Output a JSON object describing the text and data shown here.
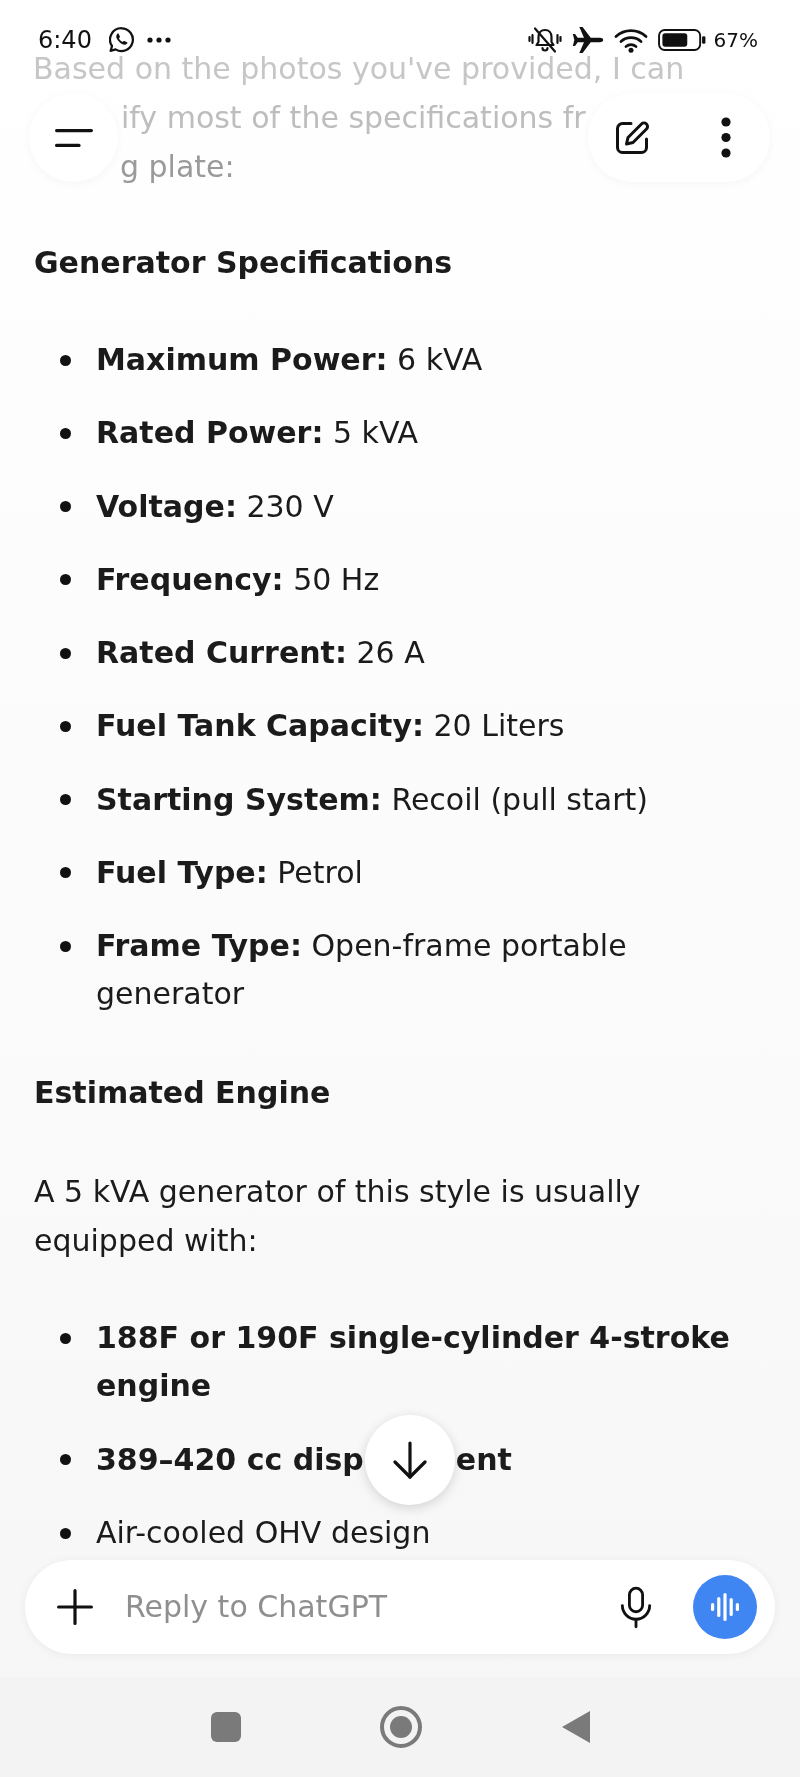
{
  "status_bar": {
    "time": "6:40",
    "battery": "67%"
  },
  "message": {
    "cut_lines": [
      "Based on the photos you've provided, I can",
      "ify most of the specifications fr",
      "g plate:"
    ],
    "sections": [
      {
        "heading": "Generator Specifications",
        "items": [
          {
            "text": "**Maximum Power:** 6 kVA"
          },
          {
            "text": "**Rated Power:** 5 kVA"
          },
          {
            "text": "**Voltage:** 230 V"
          },
          {
            "text": "**Frequency:** 50 Hz"
          },
          {
            "text": "**Rated Current:** 26 A"
          },
          {
            "text": "**Fuel Tank Capacity:** 20 Liters"
          },
          {
            "text": "**Starting System:** Recoil (pull start)"
          },
          {
            "text": "**Fuel Type:** Petrol"
          },
          {
            "text": "**Frame Type:** Open-frame portable generator"
          }
        ]
      },
      {
        "heading": "Estimated Engine",
        "paragraph": "A 5 kVA generator of this style is usually equipped with:",
        "items": [
          {
            "text": "188F or 190F single-cylinder 4-stroke engine",
            "bold": true
          },
          {
            "text": "389–420 cc disp",
            "text_after_cover": "ent",
            "bold": true
          },
          {
            "text": "Air-cooled OHV design",
            "bold": false
          }
        ]
      }
    ]
  },
  "composer": {
    "placeholder": "Reply to ChatGPT"
  }
}
